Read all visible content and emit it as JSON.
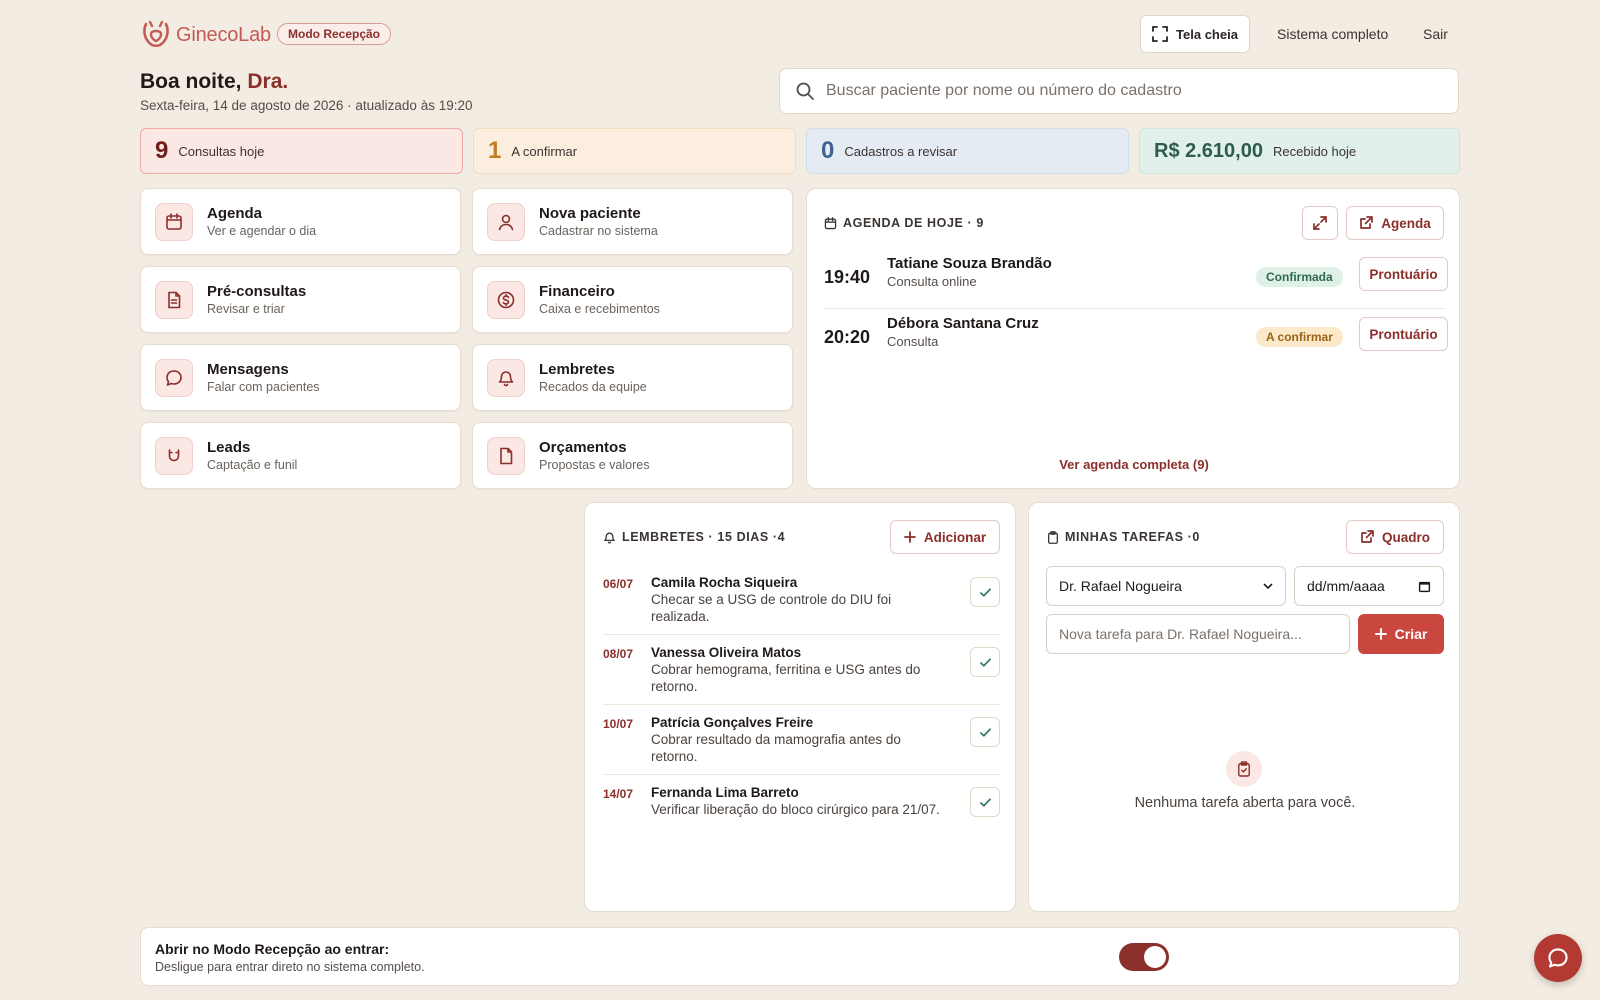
{
  "header": {
    "logo_text": "GinecoLab",
    "mode_badge": "Modo Recepção",
    "fullscreen_label": "Tela cheia",
    "full_system_label": "Sistema completo",
    "logout_label": "Sair"
  },
  "greeting": {
    "prefix": "Boa noite,",
    "name": "Dra.",
    "date_line": "Sexta-feira, 14 de agosto de 2026 · atualizado às 19:20"
  },
  "search": {
    "placeholder": "Buscar paciente por nome ou número do cadastro"
  },
  "stats": [
    {
      "value": "9",
      "label": "Consultas hoje"
    },
    {
      "value": "1",
      "label": "A confirmar"
    },
    {
      "value": "0",
      "label": "Cadastros a revisar"
    },
    {
      "value": "R$ 2.610,00",
      "label": "Recebido hoje"
    }
  ],
  "tiles": [
    {
      "title": "Agenda",
      "subtitle": "Ver e agendar o dia",
      "icon": "calendar-icon"
    },
    {
      "title": "Nova paciente",
      "subtitle": "Cadastrar no sistema",
      "icon": "user-icon"
    },
    {
      "title": "Pré-consultas",
      "subtitle": "Revisar e triar",
      "icon": "document-icon"
    },
    {
      "title": "Financeiro",
      "subtitle": "Caixa e recebimentos",
      "icon": "dollar-icon"
    },
    {
      "title": "Mensagens",
      "subtitle": "Falar com pacientes",
      "icon": "chat-icon"
    },
    {
      "title": "Lembretes",
      "subtitle": "Recados da equipe",
      "icon": "bell-icon"
    },
    {
      "title": "Leads",
      "subtitle": "Captação e funil",
      "icon": "magnet-icon"
    },
    {
      "title": "Orçamentos",
      "subtitle": "Propostas e valores",
      "icon": "file-icon"
    }
  ],
  "agenda": {
    "title": "AGENDA DE HOJE · 9",
    "agenda_button": "Agenda",
    "view_all": "Ver agenda completa (9)",
    "appointments": [
      {
        "time": "19:40",
        "name": "Tatiane Souza Brandão",
        "type": "Consulta online",
        "status": "Confirmada",
        "action": "Prontuário"
      },
      {
        "time": "20:20",
        "name": "Débora Santana Cruz",
        "type": "Consulta",
        "status": "A confirmar",
        "action": "Prontuário"
      }
    ]
  },
  "reminders": {
    "title": "LEMBRETES · 15 DIAS ·4",
    "add_label": "Adicionar",
    "items": [
      {
        "date": "06/07",
        "name": "Camila Rocha Siqueira",
        "text": "Checar se a USG de controle do DIU foi realizada."
      },
      {
        "date": "08/07",
        "name": "Vanessa Oliveira Matos",
        "text": "Cobrar hemograma, ferritina e USG antes do retorno."
      },
      {
        "date": "10/07",
        "name": "Patrícia Gonçalves Freire",
        "text": "Cobrar resultado da mamografia antes do retorno."
      },
      {
        "date": "14/07",
        "name": "Fernanda Lima Barreto",
        "text": "Verificar liberação do bloco cirúrgico para 21/07."
      }
    ]
  },
  "tasks": {
    "title": "MINHAS TAREFAS ·0",
    "board_label": "Quadro",
    "assignee": "Dr. Rafael Nogueira",
    "date_placeholder": "dd/mm/aaaa",
    "new_task_placeholder": "Nova tarefa para Dr. Rafael Nogueira...",
    "create_label": "Criar",
    "empty_text": "Nenhuma tarefa aberta para você."
  },
  "footer": {
    "title": "Abrir no Modo Recepção ao entrar:",
    "subtitle": "Desligue para entrar direto no sistema completo.",
    "toggle_on": true
  },
  "colors": {
    "brand": "#8b2f2b",
    "accent": "#c9473f",
    "background": "#f2ece2"
  }
}
